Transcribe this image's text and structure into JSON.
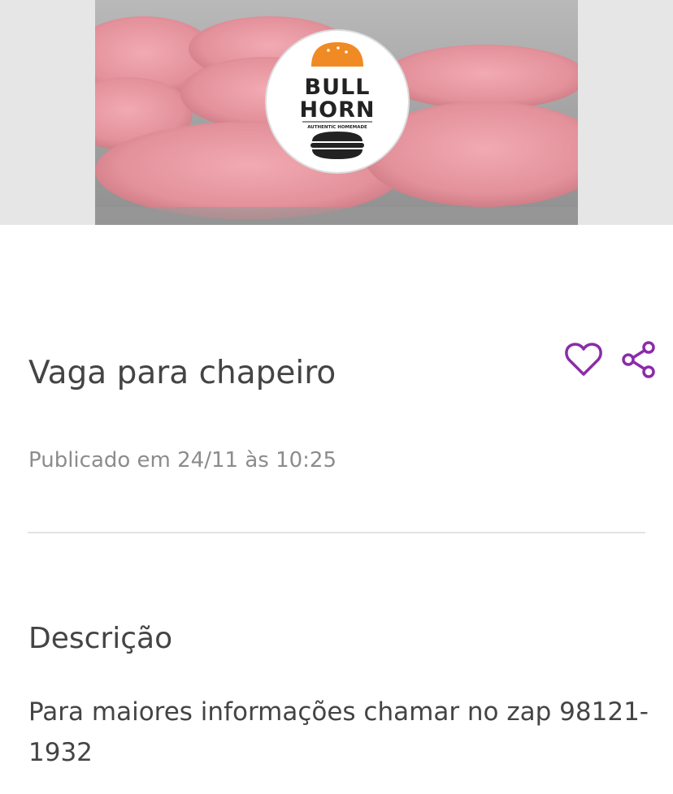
{
  "listing": {
    "image": {
      "description_icon": "hamburger-patties-photo",
      "logo": {
        "line1": "BULL",
        "line2": "HORN",
        "tagline": "AUTHENTIC HOMEMADE"
      }
    },
    "title": "Vaga para chapeiro",
    "published": "Publicado em 24/11 às 10:25",
    "actions": {
      "favorite_icon": "heart-outline-icon",
      "share_icon": "share-icon"
    }
  },
  "description": {
    "heading": "Descrição",
    "body": "Para maiores informações chamar no zap 98121-1932"
  },
  "colors": {
    "accent": "#8a2ca8",
    "text": "#444444",
    "muted": "#8c8c8c",
    "divider": "#e3e3e3",
    "logo_orange": "#f08a24"
  }
}
